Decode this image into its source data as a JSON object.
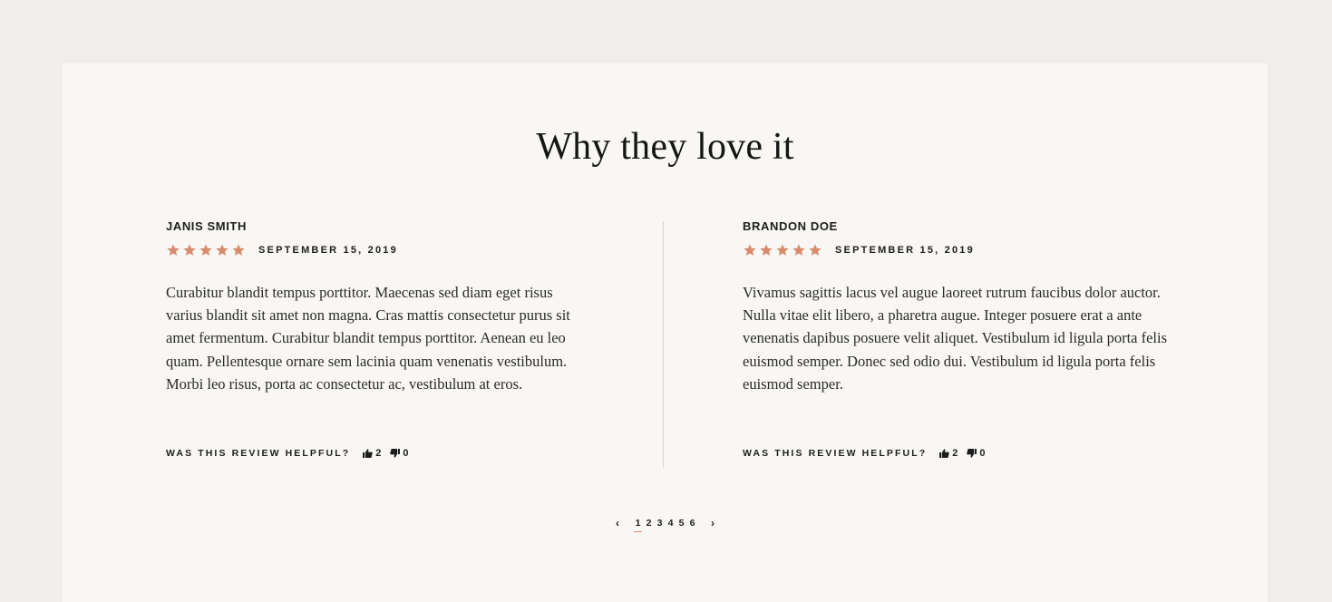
{
  "section": {
    "title": "Why they love it"
  },
  "colors": {
    "star": "#d88b6d",
    "background": "#efeeeb",
    "panel": "#f9f7f4"
  },
  "reviews": [
    {
      "author": "JANIS SMITH",
      "rating": 5,
      "date": "SEPTEMBER 15, 2019",
      "text": "Curabitur blandit tempus porttitor. Maecenas sed diam eget risus varius blandit sit amet non magna. Cras mattis consectetur purus sit amet fermentum. Curabitur blandit tempus porttitor. Aenean eu leo quam. Pellentesque ornare sem lacinia quam venenatis vestibulum. Morbi leo risus, porta ac consectetur ac, vestibulum at eros.",
      "helpful_label": "WAS THIS REVIEW HELPFUL?",
      "upvotes": "2",
      "downvotes": "0"
    },
    {
      "author": "BRANDON DOE",
      "rating": 5,
      "date": "SEPTEMBER 15, 2019",
      "text": "Vivamus sagittis lacus vel augue laoreet rutrum faucibus dolor auctor. Nulla vitae elit libero, a pharetra augue. Integer posuere erat a ante venenatis dapibus posuere velit aliquet. Vestibulum id ligula porta felis euismod semper. Donec sed odio dui. Vestibulum id ligula porta felis euismod semper.",
      "helpful_label": "WAS THIS REVIEW HELPFUL?",
      "upvotes": "2",
      "downvotes": "0"
    }
  ],
  "pagination": {
    "prev": "‹",
    "next": "›",
    "pages": [
      "1",
      "2",
      "3",
      "4",
      "5",
      "6"
    ],
    "current": "1"
  }
}
